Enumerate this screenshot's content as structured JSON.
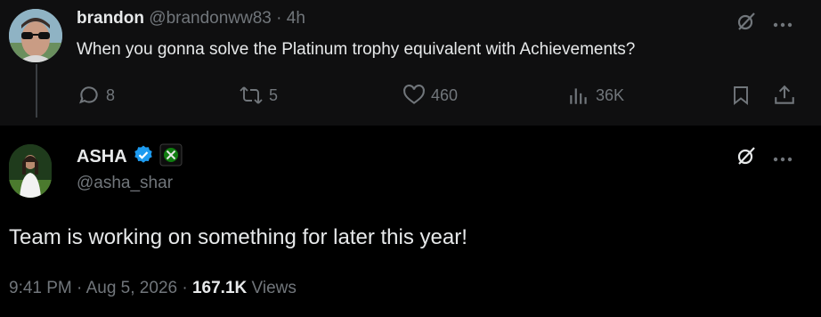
{
  "reply": {
    "name": "brandon",
    "handle": "@brandonww83",
    "separator": "·",
    "time": "4h",
    "text": "When you gonna solve the Platinum trophy equivalent with Achievements?",
    "actions": {
      "replies": "8",
      "reposts": "5",
      "likes": "460",
      "views": "36K"
    }
  },
  "main_post": {
    "name": "ASHA",
    "handle": "@asha_shar",
    "text": "Team is working on something for later this year!",
    "meta": {
      "timestamp": "9:41 PM · Aug 5, 2026 ·",
      "views_count": "167.1K",
      "views_label": "Views"
    }
  },
  "colors": {
    "background": "#000000",
    "reply_background": "#0f0f10",
    "text": "#e7e9ea",
    "muted": "#71767b",
    "verified": "#1d9bf0"
  }
}
